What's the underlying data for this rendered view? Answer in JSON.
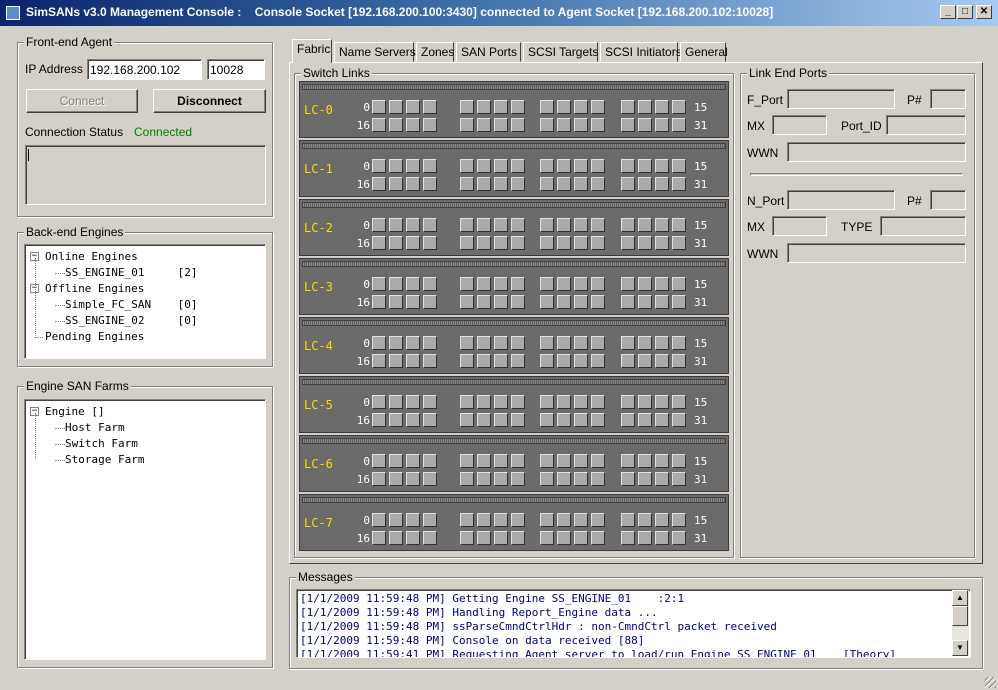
{
  "window": {
    "title": "SimSANs v3.0 Management Console :    Console Socket [192.168.200.100:3430] connected to Agent Socket [192.168.200.102:10028]",
    "min_glyph": "_",
    "max_glyph": "□",
    "close_glyph": "✕"
  },
  "frontend": {
    "group_label": "Front-end Agent",
    "ip_label": "IP Address",
    "ip_value": "192.168.200.102",
    "port_value": "10028",
    "connect_label": "Connect",
    "disconnect_label": "Disconnect",
    "status_label": "Connection Status",
    "status_value": "Connected",
    "status_color": "#008000"
  },
  "backend": {
    "group_label": "Back-end Engines",
    "tree": [
      {
        "text": "Online Engines",
        "level": 0,
        "expander": "−"
      },
      {
        "text": "SS_ENGINE_01     [2]",
        "level": 1
      },
      {
        "text": "Offline Engines",
        "level": 0,
        "expander": "−"
      },
      {
        "text": "Simple_FC_SAN    [0]",
        "level": 1
      },
      {
        "text": "SS_ENGINE_02     [0]",
        "level": 1
      },
      {
        "text": "Pending Engines",
        "level": 0
      }
    ]
  },
  "farms": {
    "group_label": "Engine SAN Farms",
    "tree": [
      {
        "text": "Engine []",
        "level": 0,
        "expander": "−"
      },
      {
        "text": "Host Farm",
        "level": 1
      },
      {
        "text": "Switch Farm",
        "level": 1
      },
      {
        "text": "Storage Farm",
        "level": 1
      }
    ]
  },
  "tabs": [
    "Fabric",
    "Name Servers",
    "Zones",
    "SAN Ports",
    "SCSI Targets",
    "SCSI Initiators",
    "General"
  ],
  "active_tab": 0,
  "switch_links": {
    "group_label": "Switch Links",
    "cards": [
      {
        "name": "LC-0",
        "row1_start": "0",
        "row1_end": "15",
        "row2_start": "16",
        "row2_end": "31"
      },
      {
        "name": "LC-1",
        "row1_start": "0",
        "row1_end": "15",
        "row2_start": "16",
        "row2_end": "31"
      },
      {
        "name": "LC-2",
        "row1_start": "0",
        "row1_end": "15",
        "row2_start": "16",
        "row2_end": "31"
      },
      {
        "name": "LC-3",
        "row1_start": "0",
        "row1_end": "15",
        "row2_start": "16",
        "row2_end": "31"
      },
      {
        "name": "LC-4",
        "row1_start": "0",
        "row1_end": "15",
        "row2_start": "16",
        "row2_end": "31"
      },
      {
        "name": "LC-5",
        "row1_start": "0",
        "row1_end": "15",
        "row2_start": "16",
        "row2_end": "31"
      },
      {
        "name": "LC-6",
        "row1_start": "0",
        "row1_end": "15",
        "row2_start": "16",
        "row2_end": "31"
      },
      {
        "name": "LC-7",
        "row1_start": "0",
        "row1_end": "15",
        "row2_start": "16",
        "row2_end": "31"
      }
    ],
    "lc_label_color": "#ffd800"
  },
  "link_end_ports": {
    "group_label": "Link End Ports",
    "f_port_label": "F_Port",
    "f_pnum_label": "P#",
    "f_mx_label": "MX",
    "f_portid_label": "Port_ID",
    "f_wwn_label": "WWN",
    "n_port_label": "N_Port",
    "n_pnum_label": "P#",
    "n_mx_label": "MX",
    "n_type_label": "TYPE",
    "n_wwn_label": "WWN"
  },
  "messages": {
    "group_label": "Messages",
    "lines": [
      "[1/1/2009 11:59:48 PM] Getting Engine SS_ENGINE_01    :2:1",
      "[1/1/2009 11:59:48 PM] Handling Report_Engine data ...",
      "[1/1/2009 11:59:48 PM] ssParseCmndCtrlHdr : non-CmndCtrl packet received",
      "[1/1/2009 11:59:48 PM] Console on data received [88]",
      "[1/1/2009 11:59:41 PM] Requesting Agent server to load/run Engine SS_ENGINE_01    [Theory]"
    ],
    "up_glyph": "▲",
    "down_glyph": "▼"
  }
}
